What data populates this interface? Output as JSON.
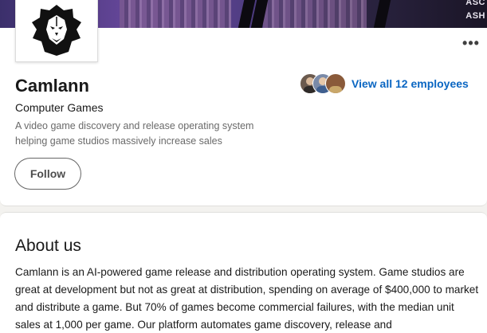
{
  "cover": {
    "corner_text_lines": [
      "ASC",
      "ASH"
    ]
  },
  "company": {
    "name": "Camlann",
    "industry": "Computer Games",
    "tagline": "A video game discovery and release operating system helping game studios massively increase sales",
    "logo_icon": "lion-head-logo"
  },
  "actions": {
    "follow_label": "Follow",
    "more_label": "•••"
  },
  "employees": {
    "link_label": "View all 12 employees",
    "avatar_colors": [
      "#6b5a4e",
      "#7a8aa8",
      "#8a5a3a"
    ]
  },
  "about": {
    "title": "About us",
    "body": "Camlann is an AI-powered game release and distribution operating system. Game studios are great at development but not as great at distribution, spending on average of $400,000 to market and distribute a game. But 70% of games become commercial failures, with the median unit sales at 1,000 per game. Our platform automates game discovery, release and"
  },
  "colors": {
    "link_blue": "#0a66c2",
    "page_bg": "#f3f2ef",
    "card_bg": "#ffffff"
  }
}
